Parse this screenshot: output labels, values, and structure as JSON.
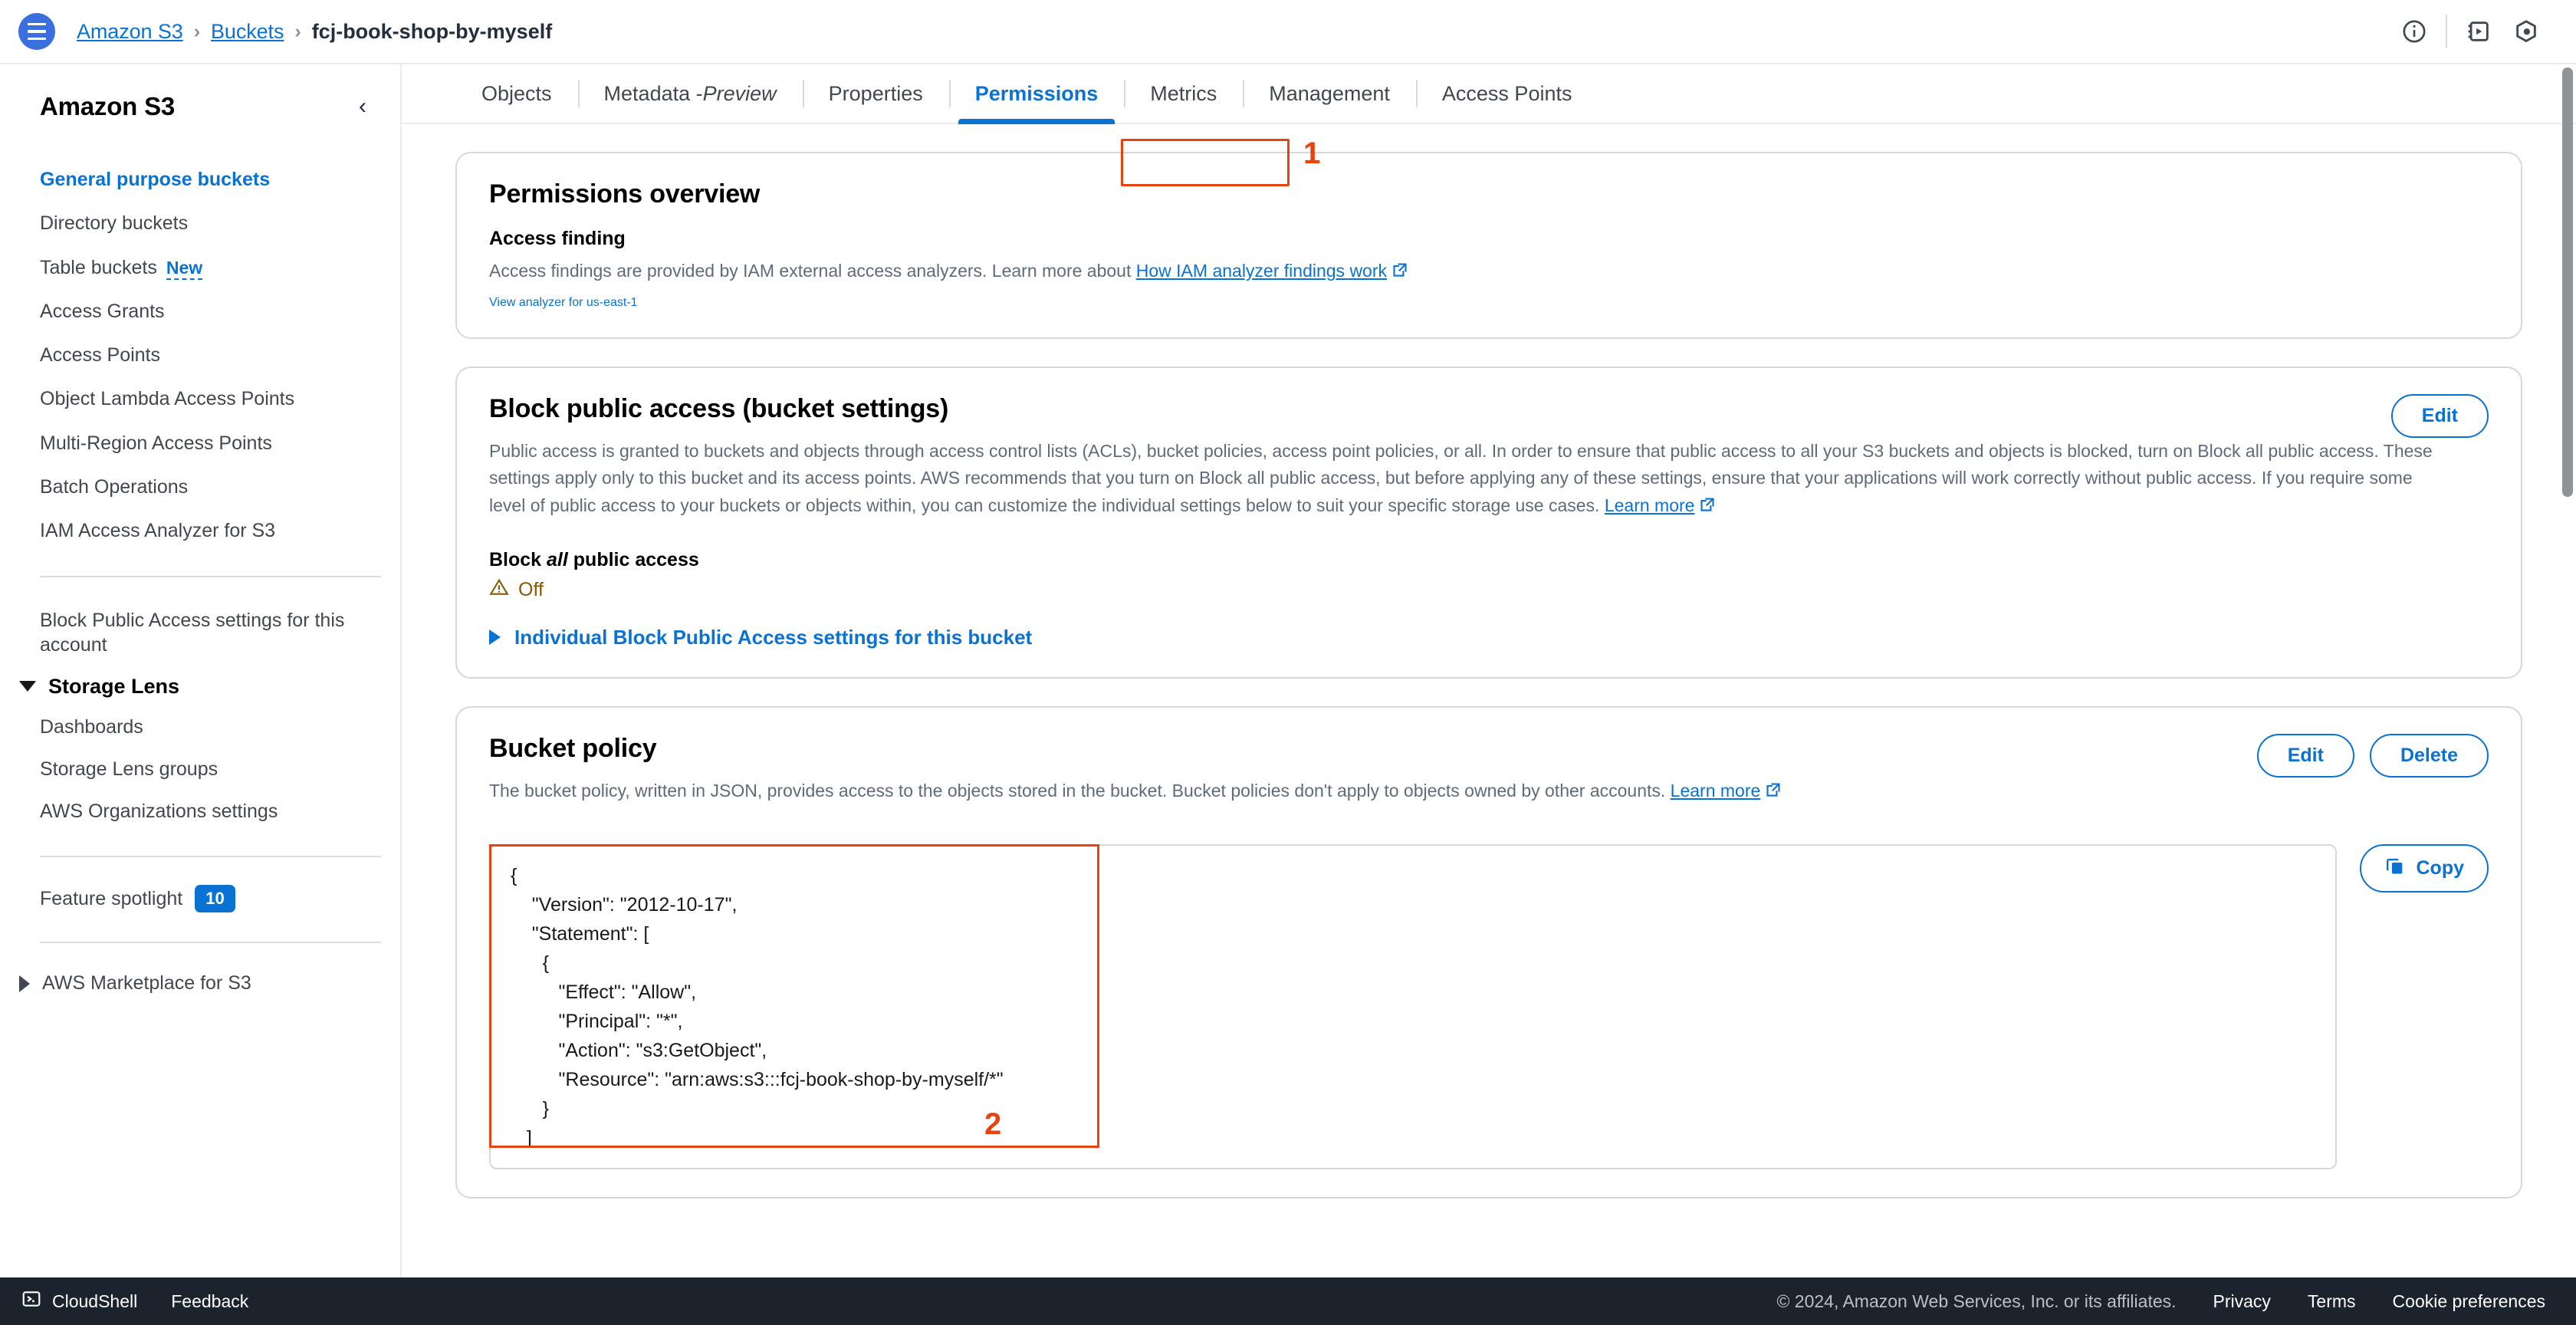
{
  "topbar": {
    "menu_icon": "hamburger-menu-icon",
    "breadcrumb": {
      "amazon_s3": "Amazon S3",
      "buckets": "Buckets",
      "separator": "›",
      "current": "fcj-book-shop-by-myself"
    },
    "icons": {
      "info": "info-circle-icon",
      "cloudshell": "cloudshell-icon",
      "settings": "settings-hex-icon"
    }
  },
  "sidebar": {
    "title": "Amazon S3",
    "collapse_icon": "chevron-left-icon",
    "items": [
      {
        "label": "General purpose buckets",
        "active": true
      },
      {
        "label": "Directory buckets",
        "active": false
      },
      {
        "label": "Table buckets",
        "active": false,
        "badge": "New"
      },
      {
        "label": "Access Grants",
        "active": false
      },
      {
        "label": "Access Points",
        "active": false
      },
      {
        "label": "Object Lambda Access Points",
        "active": false
      },
      {
        "label": "Multi-Region Access Points",
        "active": false
      },
      {
        "label": "Batch Operations",
        "active": false
      },
      {
        "label": "IAM Access Analyzer for S3",
        "active": false
      }
    ],
    "account_setting": "Block Public Access settings for this account",
    "storage_lens": {
      "label": "Storage Lens",
      "expanded": true,
      "items": [
        "Dashboards",
        "Storage Lens groups",
        "AWS Organizations settings"
      ]
    },
    "feature_spotlight": {
      "label": "Feature spotlight",
      "count": "10"
    },
    "marketplace": {
      "label": "AWS Marketplace for S3",
      "expanded": false
    }
  },
  "tabs": [
    {
      "label": "Objects",
      "active": false
    },
    {
      "label": "Metadata - ",
      "italic": "Preview",
      "active": false
    },
    {
      "label": "Properties",
      "active": false
    },
    {
      "label": "Permissions",
      "active": true
    },
    {
      "label": "Metrics",
      "active": false
    },
    {
      "label": "Management",
      "active": false
    },
    {
      "label": "Access Points",
      "active": false
    }
  ],
  "permissions_overview": {
    "title": "Permissions overview",
    "access_finding_label": "Access finding",
    "description": "Access findings are provided by IAM external access analyzers. Learn more about ",
    "learn_link": "How IAM analyzer findings work",
    "view_analyzer_link": "View analyzer for us-east-1"
  },
  "block_public_access": {
    "title": "Block public access (bucket settings)",
    "edit_label": "Edit",
    "description": "Public access is granted to buckets and objects through access control lists (ACLs), bucket policies, access point policies, or all. In order to ensure that public access to all your S3 buckets and objects is blocked, turn on Block all public access. These settings apply only to this bucket and its access points. AWS recommends that you turn on Block all public access, but before applying any of these settings, ensure that your applications will work correctly without public access. If you require some level of public access to your buckets or objects within, you can customize the individual settings below to suit your specific storage use cases. ",
    "learn_more": "Learn more",
    "block_all_prefix": "Block ",
    "block_all_italic": "all",
    "block_all_suffix": " public access",
    "status": "Off",
    "warning_icon": "warning-triangle-icon",
    "individual_settings_link": "Individual Block Public Access settings for this bucket"
  },
  "bucket_policy": {
    "title": "Bucket policy",
    "edit_label": "Edit",
    "delete_label": "Delete",
    "description": "The bucket policy, written in JSON, provides access to the objects stored in the bucket. Bucket policies don't apply to objects owned by other accounts. ",
    "learn_more": "Learn more",
    "copy_label": "Copy",
    "copy_icon": "copy-icon",
    "policy_json": "{\n    \"Version\": \"2012-10-17\",\n    \"Statement\": [\n      {\n         \"Effect\": \"Allow\",\n         \"Principal\": \"*\",\n         \"Action\": \"s3:GetObject\",\n         \"Resource\": \"arn:aws:s3:::fcj-book-shop-by-myself/*\"\n      }\n   ]"
  },
  "annotations": [
    {
      "number": "1",
      "target": "permissions-tab"
    },
    {
      "number": "2",
      "target": "bucket-policy-json"
    }
  ],
  "footer": {
    "cloudshell": "CloudShell",
    "feedback": "Feedback",
    "copyright": "© 2024, Amazon Web Services, Inc. or its affiliates.",
    "links": [
      "Privacy",
      "Terms",
      "Cookie preferences"
    ]
  },
  "colors": {
    "accent": "#0972d3",
    "annotation": "#e8430f",
    "warning": "#855900",
    "footer_bg": "#1b232d"
  }
}
